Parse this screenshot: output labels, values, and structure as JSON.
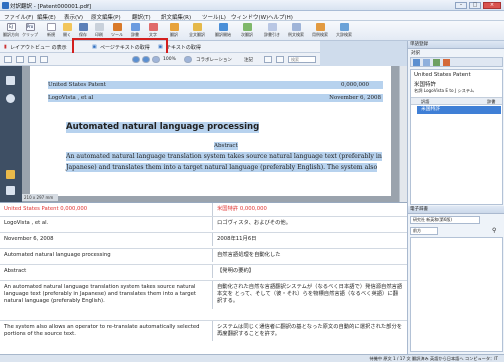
{
  "window": {
    "title": "対訳翻訳 - [Patent000001.pdf]",
    "min": "–",
    "max": "□",
    "close": "×"
  },
  "menu": [
    "ファイル(F)",
    "編集(E)",
    "表示(V)",
    "原文編集(P)",
    "翻訳(T)",
    "訳文編集(R)",
    "ツール(L)",
    "ウィンドウ(W)",
    "ヘルプ(H)"
  ],
  "ribbon": {
    "direction": "翻訳方向",
    "buttons": [
      "クリップ",
      "新規",
      "開く",
      "保存",
      "印刷",
      "ツール",
      "辞書",
      "文字",
      "翻訳",
      "全文翻訳",
      "翻訳開始",
      "次翻訳",
      "辞書引き",
      "例文検索",
      "用例検索",
      "大辞検索"
    ],
    "lang_from": "EJ",
    "lang_to": "Pro"
  },
  "toolbar2": {
    "layout": "レイアウトビュー の表示",
    "page_text": "ページテキストの取得",
    "block_text": "テキストの取得"
  },
  "toolbar3": {
    "zoom": "100%",
    "collab": "コラボレーション",
    "note": "注記",
    "search_placeholder": "検索"
  },
  "pdf": {
    "patent_left": "United States Patent",
    "patent_right": "0,000,000",
    "assignee": "LogoVista , et al",
    "date": "November 6, 2008",
    "title": "Automated natural language processing",
    "abstract_head": "Abstract",
    "abstract_line1": "An automated natural language translation system takes source natural language text (preferably in",
    "abstract_line2": "Japanese) and translates them into a target natural language (preferably English). The system also",
    "page_size": "210 x 297 mm"
  },
  "rows": [
    {
      "src": "United States Patent 0,000,000",
      "dst": "米国特許 0,000,000",
      "red": true
    },
    {
      "src": "LogoVista , et al.",
      "dst": "ロゴヴィスタ、およびその他。",
      "red": false
    },
    {
      "src": "November 6, 2008",
      "dst": "2008年11月6日",
      "red": false
    },
    {
      "src": "Automated natural language processing",
      "dst": "自然言語処理を自動化した",
      "red": false
    },
    {
      "src": "Abstract",
      "dst": "【発明の要約】",
      "red": false
    },
    {
      "src": "An automated natural language translation system takes source natural language text (preferably in Japanese) and translates them into a target natural language (preferably English).",
      "dst": "自動化された自然な言語翻訳システムが（なるべく日本語で）発信源自然言語本文を とって、そして（彼・それ）らを物標自然言語（なるべく英語）に翻訳する。",
      "red": false
    },
    {
      "src": "The system also allows an operator to re-translate automatically selected portions of the source text.",
      "dst": "システムは同じく通信者に翻訳の基となった原文の自動的に選択された部分を再度翻訳することを許す。",
      "red": false
    }
  ],
  "right_pane": {
    "dict_header": "単語登録",
    "dict_label": "対訳",
    "tree_root": "United States Patent",
    "tree_child": "米国特許",
    "tree_field": "名詞 LogoVista E to J システム",
    "col_translation": "訳語",
    "col_dictionary": "辞書",
    "selected_item": "米国特許",
    "sub_header": "電子辞書",
    "sub_dict_label": "研究社 新英和(第6版)",
    "sub_search_btn": "前方",
    "sub_all": "全文"
  },
  "status": {
    "text": "待機中  原文  1 / 17 文  翻訳済み  英語から日本語へ  コンピュータ：IT"
  },
  "colors": {
    "accent": "#2f6fc1",
    "highlight": "#b7d2ee",
    "redbox": "#d31f1f",
    "patent_red": "#e0312f"
  }
}
